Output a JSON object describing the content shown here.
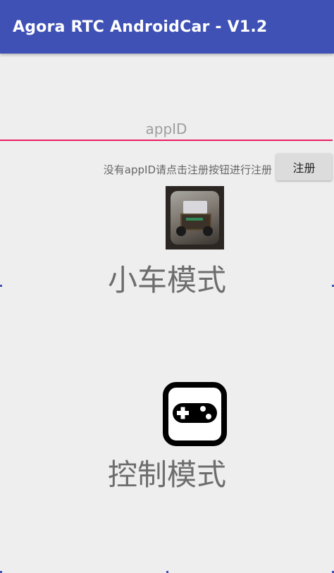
{
  "app": {
    "title": "Agora RTC AndroidCar - V1.2"
  },
  "form": {
    "appid_placeholder": "appID",
    "hint": "没有appID请点击注册按钮进行注册",
    "register_label": "注册"
  },
  "modes": [
    {
      "label": "小车模式",
      "icon": "car-photo-icon"
    },
    {
      "label": "控制模式",
      "icon": "gamepad-icon"
    }
  ],
  "colors": {
    "appbar": "#3f51b5",
    "accent": "#e91e63",
    "background": "#eeeeee"
  }
}
